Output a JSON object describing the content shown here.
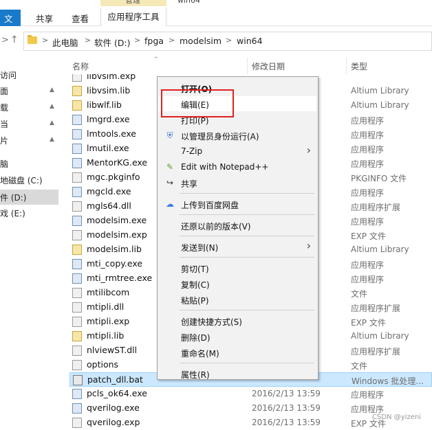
{
  "ribbon": {
    "context_group": "管理",
    "context_title": "win64",
    "tabs": [
      "文件",
      "共享",
      "查看",
      "应用程序工具"
    ]
  },
  "nav_buttons": [
    "back-arrow-icon",
    "up-arrow-icon"
  ],
  "address": {
    "crumbs": [
      "此电脑",
      "软件 (D:)",
      "fpga",
      "modelsim",
      "win64"
    ]
  },
  "navpane": {
    "items": [
      {
        "label": "访问",
        "pinned": false
      },
      {
        "label": "面",
        "pinned": true
      },
      {
        "label": "载",
        "pinned": true
      },
      {
        "label": "当",
        "pinned": true
      },
      {
        "label": "片",
        "pinned": true
      },
      {
        "label": "脑",
        "pinned": false
      },
      {
        "label": "地磁盘 (C:)",
        "pinned": false
      },
      {
        "label": "件 (D:)",
        "pinned": false,
        "selected": true
      },
      {
        "label": "戏 (E:)",
        "pinned": false
      }
    ]
  },
  "columns": {
    "name": "名称",
    "date": "修改日期",
    "type": "类型"
  },
  "files": [
    {
      "name": "libvsim.exp",
      "date": "",
      "type": "",
      "icon": "dll"
    },
    {
      "name": "libvsim.lib",
      "date": "",
      "type": "Altium Library",
      "icon": "lib"
    },
    {
      "name": "libwlf.lib",
      "date": "",
      "type": "Altium Library",
      "icon": "lib"
    },
    {
      "name": "lmgrd.exe",
      "date": "",
      "type": "应用程序",
      "icon": "exe"
    },
    {
      "name": "lmtools.exe",
      "date": "",
      "type": "应用程序",
      "icon": "exe"
    },
    {
      "name": "lmutil.exe",
      "date": "",
      "type": "应用程序",
      "icon": "exe"
    },
    {
      "name": "MentorKG.exe",
      "date": "",
      "type": "应用程序",
      "icon": "exe"
    },
    {
      "name": "mgc.pkginfo",
      "date": "",
      "type": "PKGINFO 文件",
      "icon": "dll"
    },
    {
      "name": "mgcld.exe",
      "date": "",
      "type": "应用程序",
      "icon": "exe"
    },
    {
      "name": "mgls64.dll",
      "date": "",
      "type": "应用程序扩展",
      "icon": "dll"
    },
    {
      "name": "modelsim.exe",
      "date": "",
      "type": "应用程序",
      "icon": "exe"
    },
    {
      "name": "modelsim.exp",
      "date": "",
      "type": "EXP 文件",
      "icon": "dll"
    },
    {
      "name": "modelsim.lib",
      "date": "",
      "type": "Altium Library",
      "icon": "lib"
    },
    {
      "name": "mti_copy.exe",
      "date": "",
      "type": "应用程序",
      "icon": "exe"
    },
    {
      "name": "mti_rmtree.exe",
      "date": "",
      "type": "应用程序",
      "icon": "exe"
    },
    {
      "name": "mtilibcom",
      "date": "",
      "type": "文件",
      "icon": "dll"
    },
    {
      "name": "mtipli.dll",
      "date": "",
      "type": "应用程序扩展",
      "icon": "dll"
    },
    {
      "name": "mtipli.exp",
      "date": "",
      "type": "EXP 文件",
      "icon": "dll"
    },
    {
      "name": "mtipli.lib",
      "date": "",
      "type": "Altium Library",
      "icon": "lib"
    },
    {
      "name": "nlviewST.dll",
      "date": "",
      "type": "应用程序扩展",
      "icon": "dll"
    },
    {
      "name": "options",
      "date": "",
      "type": "文件",
      "icon": "dll"
    },
    {
      "name": "patch_dll.bat",
      "date": "",
      "type": "Windows 批处理...",
      "icon": "bat",
      "selected": true
    },
    {
      "name": "pcls_ok64.exe",
      "date": "2016/2/13 13:59",
      "type": "应用程序",
      "icon": "exe"
    },
    {
      "name": "qverilog.exe",
      "date": "2016/2/13 13:59",
      "type": "应用程序",
      "icon": "exe"
    },
    {
      "name": "qverilog.exp",
      "date": "2016/2/13 13:59",
      "type": "EXP 文件",
      "icon": "dll"
    }
  ],
  "context_menu": {
    "items": [
      {
        "label": "打开(O)",
        "icon": "",
        "bold": true
      },
      {
        "label": "编辑(E)",
        "icon": "",
        "hover": true
      },
      {
        "label": "打印(P)",
        "icon": ""
      },
      {
        "label": "以管理员身份运行(A)",
        "icon": "shield-icon"
      },
      {
        "label": "7-Zip",
        "icon": "",
        "submenu": true
      },
      {
        "label": "Edit with Notepad++",
        "icon": "notepad-icon"
      },
      {
        "label": "共享",
        "icon": "share-icon"
      },
      {
        "sep": true
      },
      {
        "label": "上传到百度网盘",
        "icon": "baidu-cloud-icon"
      },
      {
        "sep": true
      },
      {
        "label": "还原以前的版本(V)",
        "icon": ""
      },
      {
        "sep": true
      },
      {
        "label": "发送到(N)",
        "icon": "",
        "submenu": true
      },
      {
        "sep": true
      },
      {
        "label": "剪切(T)",
        "icon": ""
      },
      {
        "label": "复制(C)",
        "icon": ""
      },
      {
        "label": "粘贴(P)",
        "icon": ""
      },
      {
        "sep": true
      },
      {
        "label": "创建快捷方式(S)",
        "icon": ""
      },
      {
        "label": "删除(D)",
        "icon": ""
      },
      {
        "label": "重命名(M)",
        "icon": ""
      },
      {
        "sep": true
      },
      {
        "label": "属性(R)",
        "icon": ""
      }
    ]
  },
  "watermark": "CSDN @yizeni",
  "colors": {
    "highlight_box": "#e02020",
    "selection": "#cce8ff",
    "accent": "#1979ca"
  }
}
